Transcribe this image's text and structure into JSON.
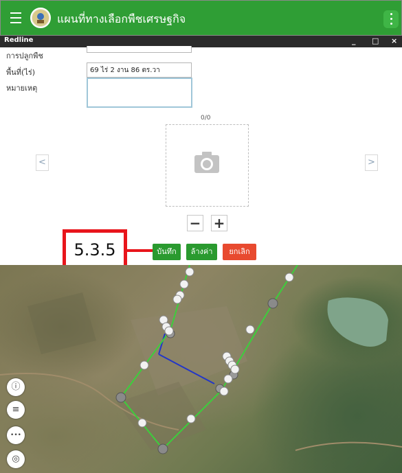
{
  "app": {
    "title": "แผนที่ทางเลือกพืชเศรษฐกิจ"
  },
  "panel": {
    "title": "Redline",
    "minimize_glyph": "_",
    "maximize_glyph": "□",
    "close_glyph": "×"
  },
  "form": {
    "planting_label": "การปลูกพืช",
    "area_label": "พื้นที่(ไร่)",
    "area_value": "69 ไร่ 2 งาน 86 ตร.วา",
    "note_label": "หมายเหตุ",
    "note_value": ""
  },
  "photo": {
    "counter": "0/0",
    "prev_glyph": "<",
    "next_glyph": ">",
    "zoom_out_glyph": "−",
    "zoom_in_glyph": "+"
  },
  "callout": {
    "label": "5.3.5"
  },
  "actions": {
    "save_label": "บันทึก",
    "clear_label": "ล้างค่า",
    "cancel_label": "ยกเลิก"
  },
  "map_controls": {
    "info_glyph": "ⓘ",
    "layers_glyph": "≡",
    "more_glyph": "•••",
    "locate_glyph": "◎"
  },
  "colors": {
    "appbar": "#2f9e35",
    "save_button": "#2a9a2f",
    "clear_button": "#2a9a2f",
    "cancel_button": "#e84a2f",
    "callout_border": "#e8151b",
    "polygon_line": "#3ccf3c",
    "measure_line": "#2236c8"
  }
}
